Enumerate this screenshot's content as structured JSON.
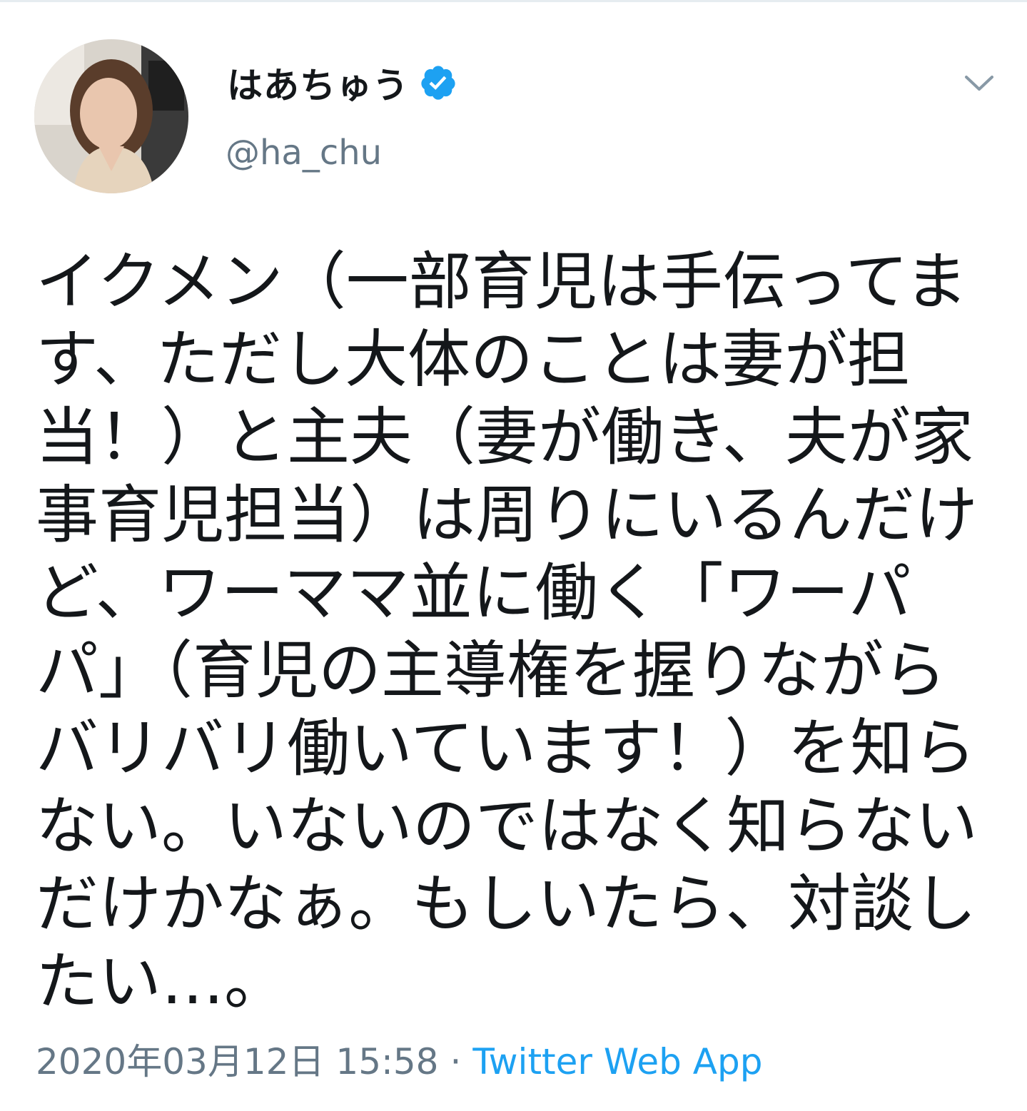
{
  "user": {
    "display_name": "はあちゅう",
    "handle": "@ha_chu",
    "verified": true
  },
  "tweet": {
    "lines": [
      "イクメン（一部育児は手伝ってま",
      "す、ただし大体のことは妻が担",
      "当！）と主夫（妻が働き、夫が家",
      "事育児担当）は周りにいるんだけ",
      "ど、ワーママ並に働く「ワーパ",
      "パ」（育児の主導権を握りながら",
      "バリバリ働いています！）を知ら",
      "ない。いないのではなく知らない",
      "だけかなぁ。もしいたら、対談し",
      "たい…。"
    ],
    "timestamp": "2020年03月12日 15:58",
    "separator": "·",
    "source": "Twitter Web App"
  },
  "icons": {
    "verified": "verified-badge-icon",
    "menu": "chevron-down-icon"
  },
  "colors": {
    "text": "#14171a",
    "secondary": "#657786",
    "accent": "#1da1f2"
  }
}
